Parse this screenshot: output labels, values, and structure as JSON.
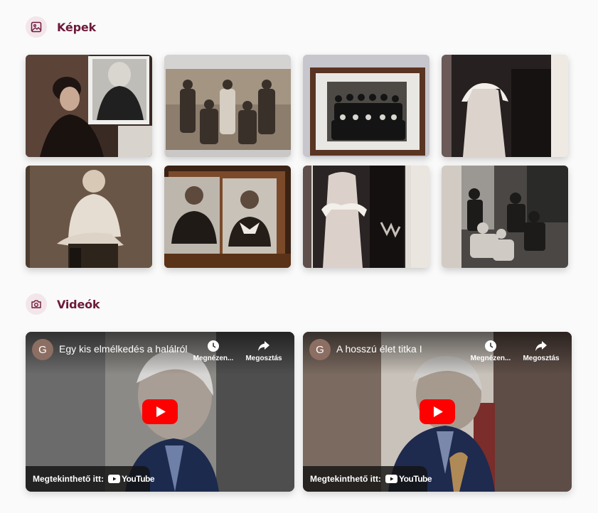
{
  "sections": {
    "images": {
      "title": "Képek",
      "icon": "image-icon"
    },
    "videos": {
      "title": "Videók",
      "icon": "camera-icon"
    }
  },
  "photos": [
    {
      "description": "Sepia portrait of a woman with a cloche hat, overlapping a portrait of an older woman in a headscarf"
    },
    {
      "description": "Sepia group photograph of a family of seven"
    },
    {
      "description": "Framed black-and-white family group photograph hanging on a wall"
    },
    {
      "description": "Bride in white dress with fur trimmed bolero"
    },
    {
      "description": "Sepia portrait of a toddler in a white outfit"
    },
    {
      "description": "Two portraits of a man and a woman in an ornate carved frame"
    },
    {
      "description": "Bride and groom in wedding attire"
    },
    {
      "description": "Black-and-white snapshot of a group of people seated outdoors"
    }
  ],
  "videos": [
    {
      "avatar_letter": "G",
      "title": "Egy kis elmélkedés a halálról",
      "watch_later": "Megnézen...",
      "share": "Megosztás",
      "watch_on": "Megtekinthető itt:",
      "platform": "YouTube"
    },
    {
      "avatar_letter": "G",
      "title": "A hosszú élet titka I",
      "watch_later": "Megnézen...",
      "share": "Megosztás",
      "watch_on": "Megtekinthető itt:",
      "platform": "YouTube"
    }
  ],
  "colors": {
    "accent": "#6d1a3a",
    "icon_bg": "#f3e6ea",
    "youtube_red": "#ff0000"
  }
}
